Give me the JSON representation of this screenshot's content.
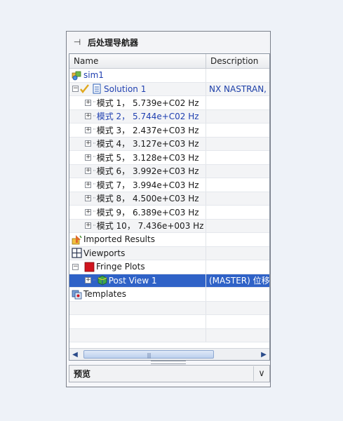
{
  "panel": {
    "pin_icon": "pin-icon",
    "title": "后处理导航器"
  },
  "columns": {
    "name": "Name",
    "description": "Description"
  },
  "rows": [
    {
      "name": "sim1",
      "description": ""
    },
    {
      "name": "Solution 1",
      "description": "NX NASTRAN, S"
    },
    {
      "name": "模式 1， 5.739e+C02 Hz",
      "description": ""
    },
    {
      "name": "模式 2， 5.744e+C02 Hz",
      "description": ""
    },
    {
      "name": "模式 3， 2.437e+C03 Hz",
      "description": ""
    },
    {
      "name": "模式 4， 3.127e+C03 Hz",
      "description": ""
    },
    {
      "name": "模式 5， 3.128e+C03 Hz",
      "description": ""
    },
    {
      "name": "模式 6， 3.992e+C03 Hz",
      "description": ""
    },
    {
      "name": "模式 7， 3.994e+C03 Hz",
      "description": ""
    },
    {
      "name": "模式 8， 4.500e+C03 Hz",
      "description": ""
    },
    {
      "name": "模式 9， 6.389e+C03 Hz",
      "description": ""
    },
    {
      "name": "模式 10， 7.436e+003 Hz",
      "description": ""
    },
    {
      "name": "Imported Results",
      "description": ""
    },
    {
      "name": "Viewports",
      "description": ""
    },
    {
      "name": "Fringe Plots",
      "description": ""
    },
    {
      "name": "Post View 1",
      "description": "(MASTER) 位移 -"
    },
    {
      "name": "Templates",
      "description": ""
    }
  ],
  "preview": {
    "title": "预览",
    "toggle_icon": "chevron-down-icon"
  },
  "scroll": {
    "left_icon": "scroll-left-icon",
    "right_icon": "scroll-right-icon"
  }
}
